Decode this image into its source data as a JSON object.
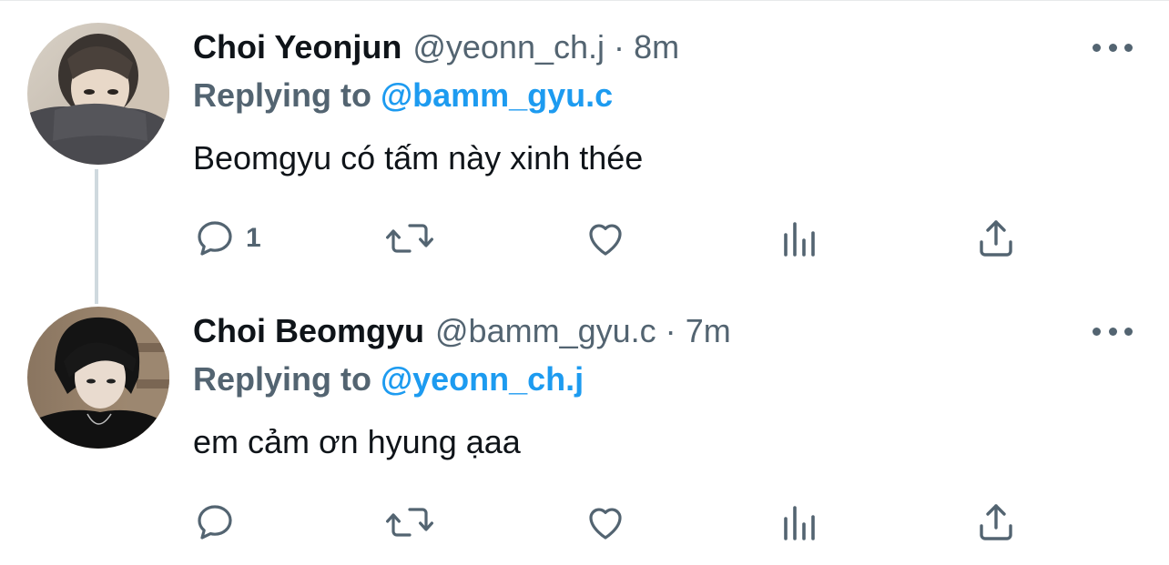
{
  "tweets": [
    {
      "display_name": "Choi Yeonjun",
      "handle": "@yeonn_ch.j",
      "separator": "·",
      "time": "8m",
      "replying_prefix": "Replying to",
      "replying_to": "@bamm_gyu.c",
      "text": "Beomgyu có tấm này xinh thée",
      "reply_count": "1",
      "avatar_icon": "profile-photo-masked-person"
    },
    {
      "display_name": "Choi Beomgyu",
      "handle": "@bamm_gyu.c",
      "separator": "·",
      "time": "7m",
      "replying_prefix": "Replying to",
      "replying_to": "@yeonn_ch.j",
      "text": "em cảm ơn hyung ạaa",
      "reply_count": "",
      "avatar_icon": "profile-photo-dark-hair-person"
    }
  ],
  "icons": {
    "reply": "reply-icon",
    "retweet": "retweet-icon",
    "like": "heart-icon",
    "views": "views-icon",
    "share": "share-icon",
    "more": "more-icon"
  },
  "colors": {
    "text": "#0f1419",
    "secondary": "#536471",
    "link": "#1d9bf0",
    "thread_line": "#cfd9de"
  }
}
